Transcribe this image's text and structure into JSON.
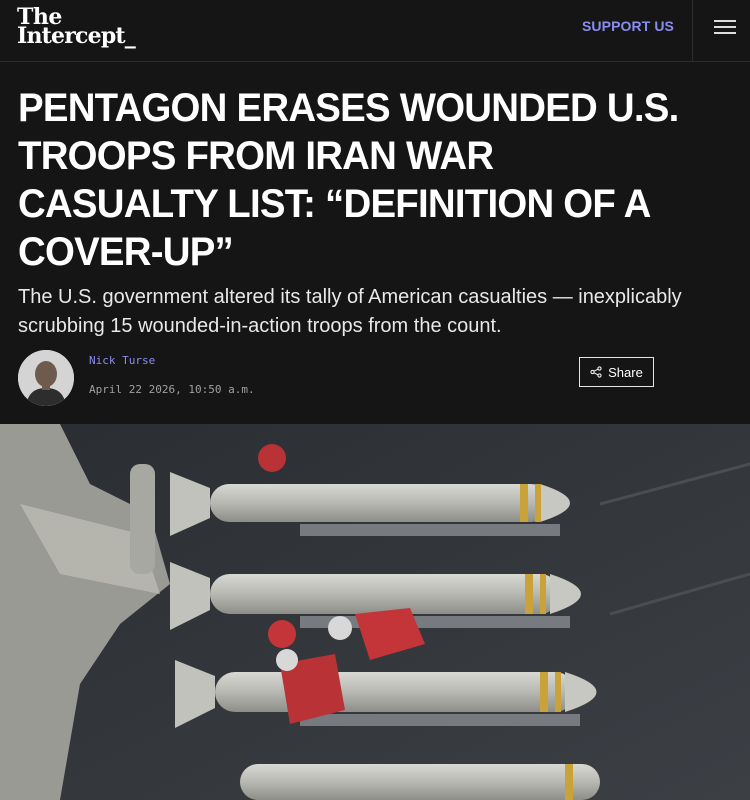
{
  "header": {
    "logo_line1": "The",
    "logo_line2": "Intercept_",
    "support_label": "SUPPORT US",
    "menu_icon": "hamburger-icon"
  },
  "article": {
    "headline": "PENTAGON ERASES WOUNDED U.S. TROOPS FROM IRAN WAR CASUALTY LIST: “DEFINITION OF A COVER-UP”",
    "dek": "The U.S. government altered its tally of American casualties — inexplicably scrubbing 15 wounded-in-action troops from the count.",
    "author": "Nick Turse",
    "date": "April 22 2026, 10:50 a.m.",
    "share_label": "Share"
  },
  "colors": {
    "background": "#151515",
    "accent": "#8a8cf0",
    "text": "#ffffff"
  }
}
